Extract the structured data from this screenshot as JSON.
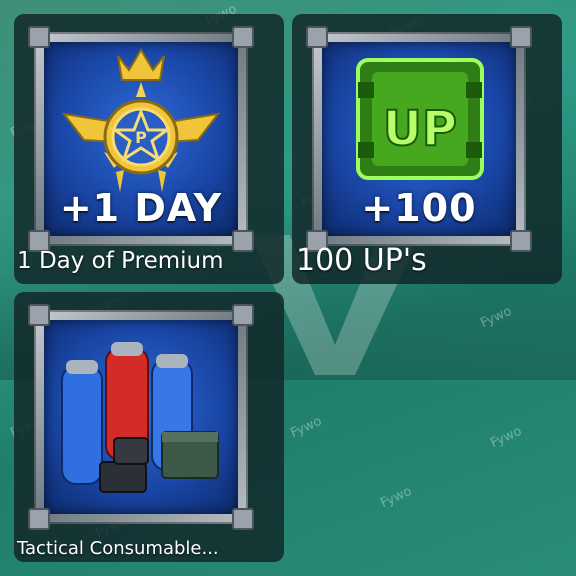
{
  "watermark": "Fywo",
  "items": [
    {
      "amount": "+1 DAY",
      "label": "1 Day of Premium",
      "icon": "premium-star-badge-icon"
    },
    {
      "amount": "+100",
      "label": "100 UP's",
      "icon": "up-token-icon"
    },
    {
      "amount": "",
      "label": "Tactical Consumable...",
      "icon": "consumable-canisters-icon"
    }
  ],
  "colors": {
    "background": "#2f9b86",
    "card": "#12282a",
    "item_bg": "#1a47a8",
    "gold": "#f0c53a",
    "up_green": "#5fe02e"
  }
}
